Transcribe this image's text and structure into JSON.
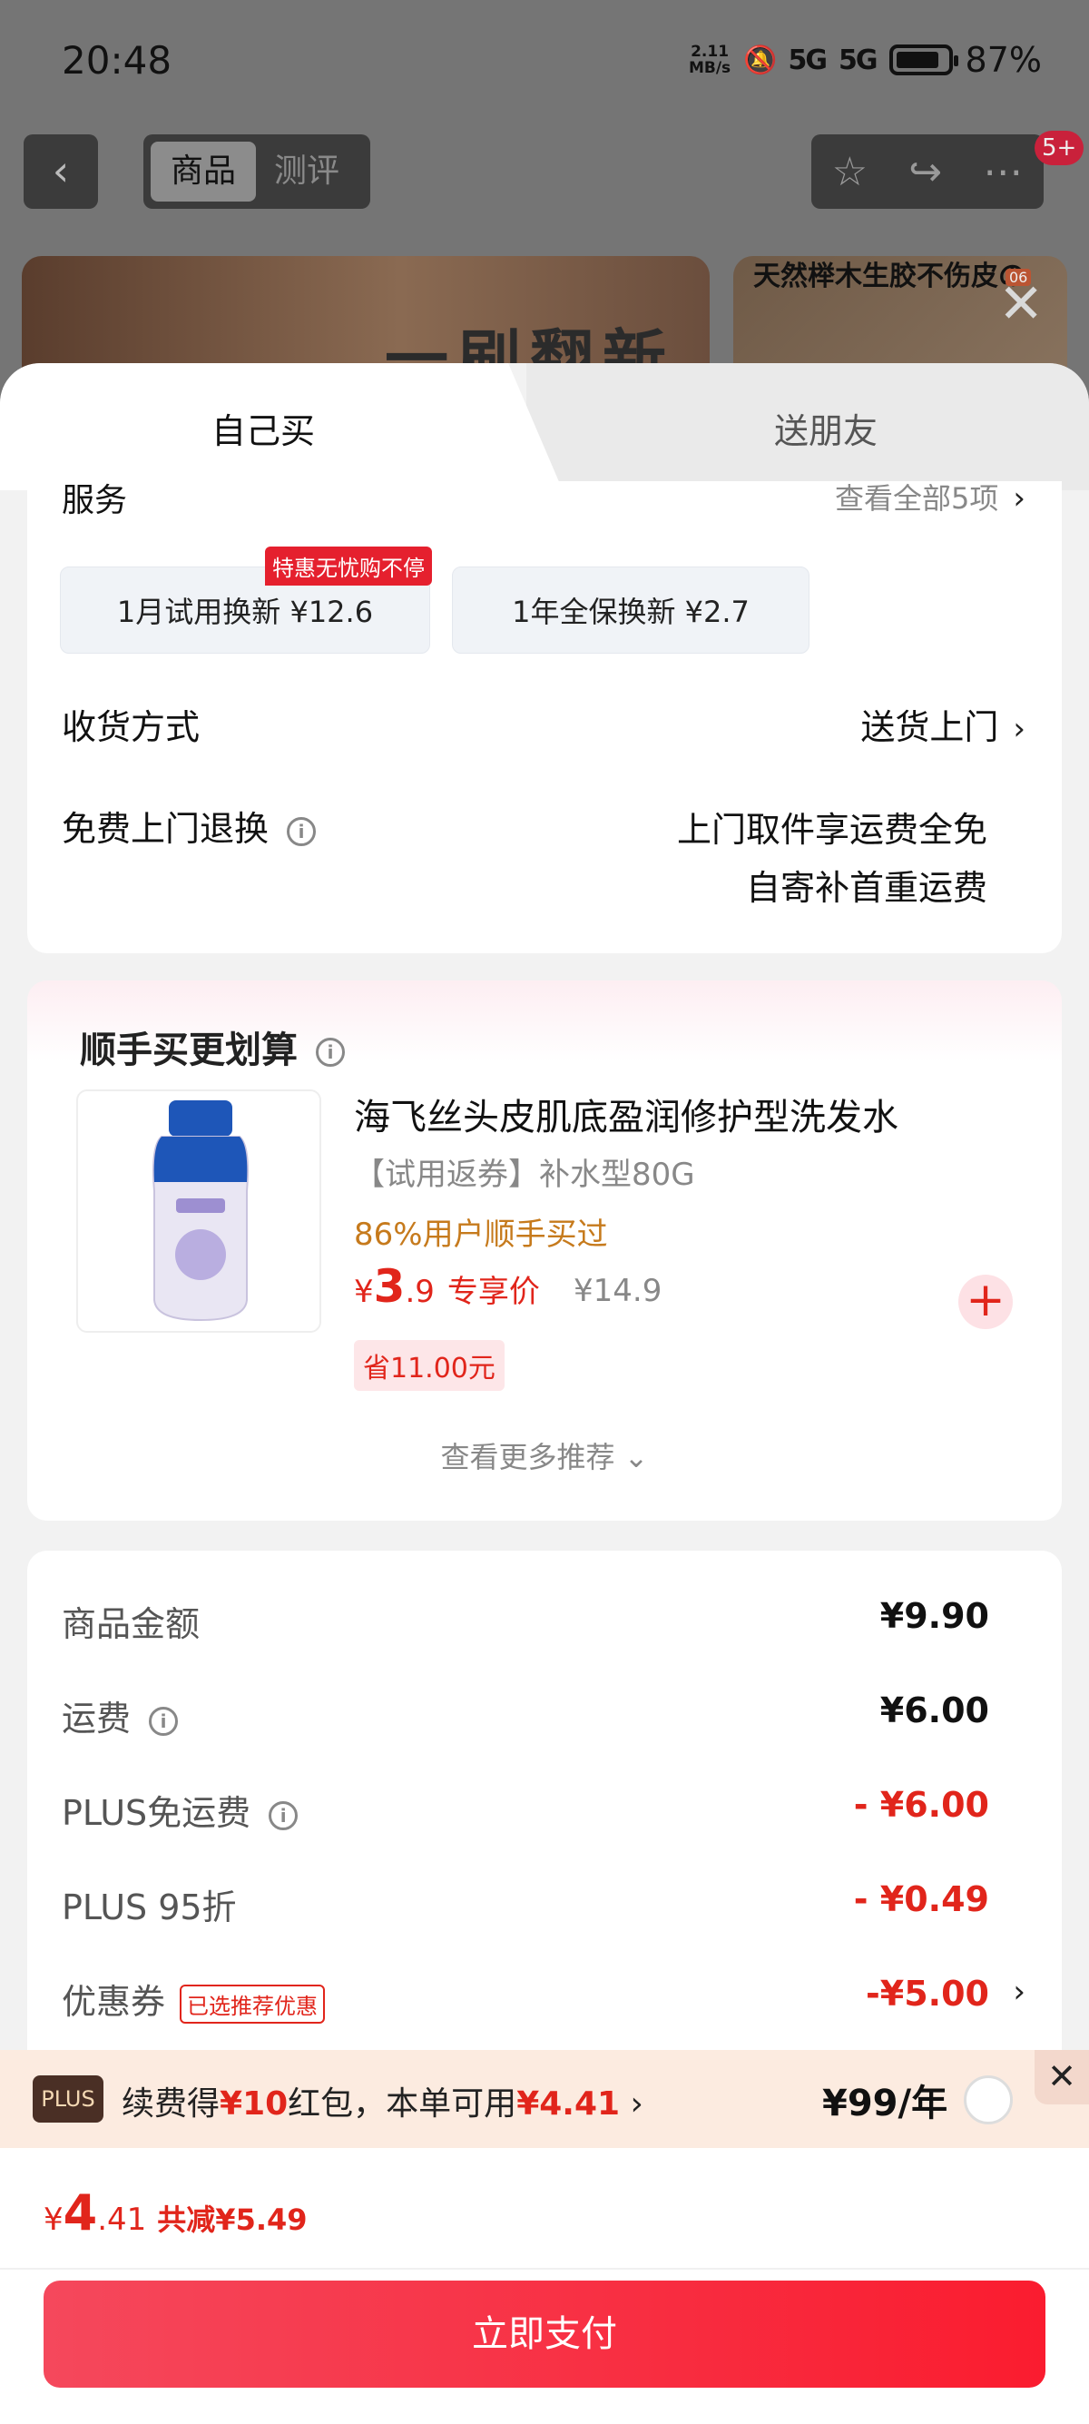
{
  "status": {
    "time": "20:48",
    "speed_top": "2.11",
    "speed_bottom": "MB/s",
    "sig1": "5G",
    "sig2": "5G",
    "battery": "87%"
  },
  "nav": {
    "back": "‹",
    "tab_goods": "商品",
    "tab_review": "测评",
    "badge": "5+"
  },
  "banner": {
    "left_text": "一刷翻新",
    "right_text": "天然榉木生胶不伤皮の",
    "page": "06"
  },
  "sheet": {
    "tab_self": "自己买",
    "tab_friend": "送朋友"
  },
  "service": {
    "title": "服务",
    "all": "查看全部5项",
    "option1": "1月试用换新  ¥12.6",
    "option1_badge": "特惠无忧购不停",
    "option2": "1年全保换新  ¥2.7",
    "delivery_label": "收货方式",
    "delivery_value": "送货上门",
    "return_label": "免费上门退换",
    "return_value1": "上门取件享运费全免",
    "return_value2": "自寄补首重运费"
  },
  "addon": {
    "title": "顺手买更划算",
    "name": "海飞丝头皮肌底盈润修护型洗发水",
    "spec": "【试用返券】补水型80G",
    "pct": "86%用户顺手买过",
    "price_symbol": "¥",
    "price_int": "3",
    "price_dec": ".9",
    "price_tag": "专享价",
    "old_price": "¥14.9",
    "save": "省11.00元",
    "more": "查看更多推荐 ⌄"
  },
  "price": {
    "goods_label": "商品金额",
    "goods_value": "¥9.90",
    "shipping_label": "运费",
    "shipping_value": "¥6.00",
    "plus_ship_label": "PLUS免运费",
    "plus_ship_value": "- ¥6.00",
    "plus95_label": "PLUS 95折",
    "plus95_value": "- ¥0.49",
    "coupon_label": "优惠券",
    "coupon_tag": "已选推荐优惠",
    "coupon_value": "-¥5.00"
  },
  "plus": {
    "logo": "PLUS",
    "t1": "续费得",
    "t2": "¥10",
    "t3": "红包，本单可用",
    "t4": "¥4.41",
    "t5": " ›",
    "year": "¥99/年"
  },
  "bottom": {
    "symbol": "¥",
    "int": "4",
    "dec": ".41",
    "saved": "共减¥5.49",
    "pay": "立即支付"
  }
}
